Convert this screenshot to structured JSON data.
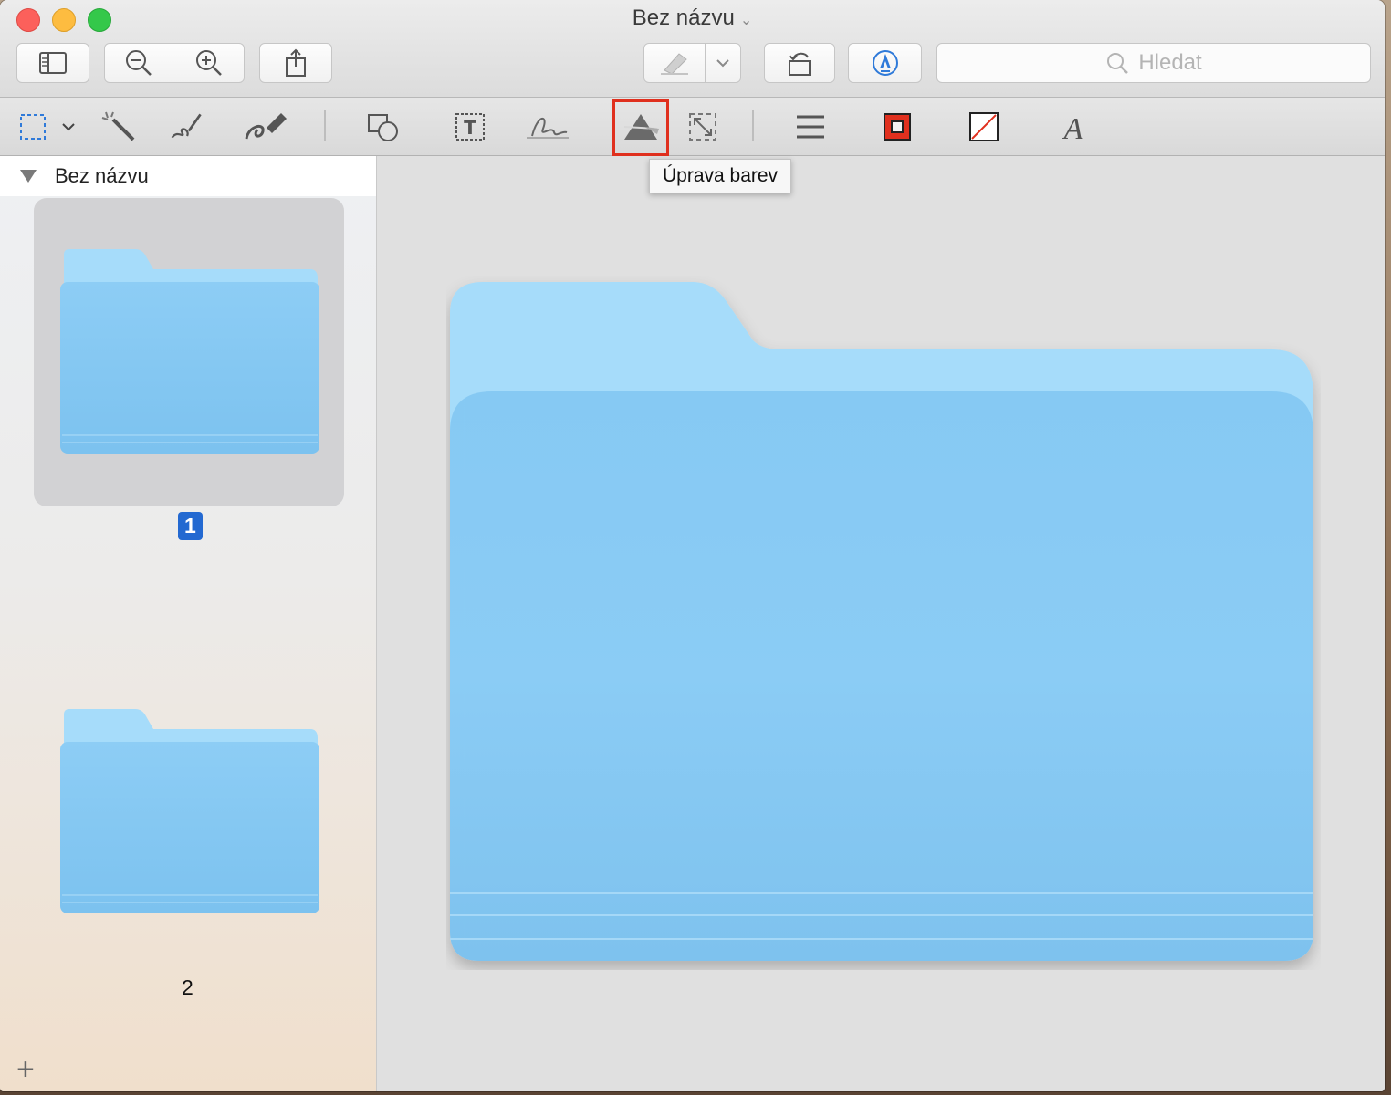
{
  "window": {
    "title": "Bez názvu",
    "title_chevron": "⌄"
  },
  "toolbar": {
    "search_placeholder": "Hledat"
  },
  "markup_toolbar": {
    "tools": [
      "rectangular-selection",
      "instant-alpha",
      "sketch",
      "draw",
      "shapes",
      "text",
      "sign",
      "adjust-color",
      "adjust-size",
      "shape-style",
      "border-color",
      "fill-color",
      "text-style"
    ],
    "highlighted_tool": "adjust-color",
    "tooltip": "Úprava barev",
    "border_color": "#e0301e",
    "fill_color": "none"
  },
  "sidebar": {
    "document_title": "Bez názvu",
    "pages": [
      {
        "label": "1",
        "selected": true
      },
      {
        "label": "2",
        "selected": false
      }
    ],
    "add_button": "+"
  },
  "colors": {
    "folder_light": "#a6dcfa",
    "folder_body": "#84c9f3",
    "selection_blue": "#2369d1"
  }
}
